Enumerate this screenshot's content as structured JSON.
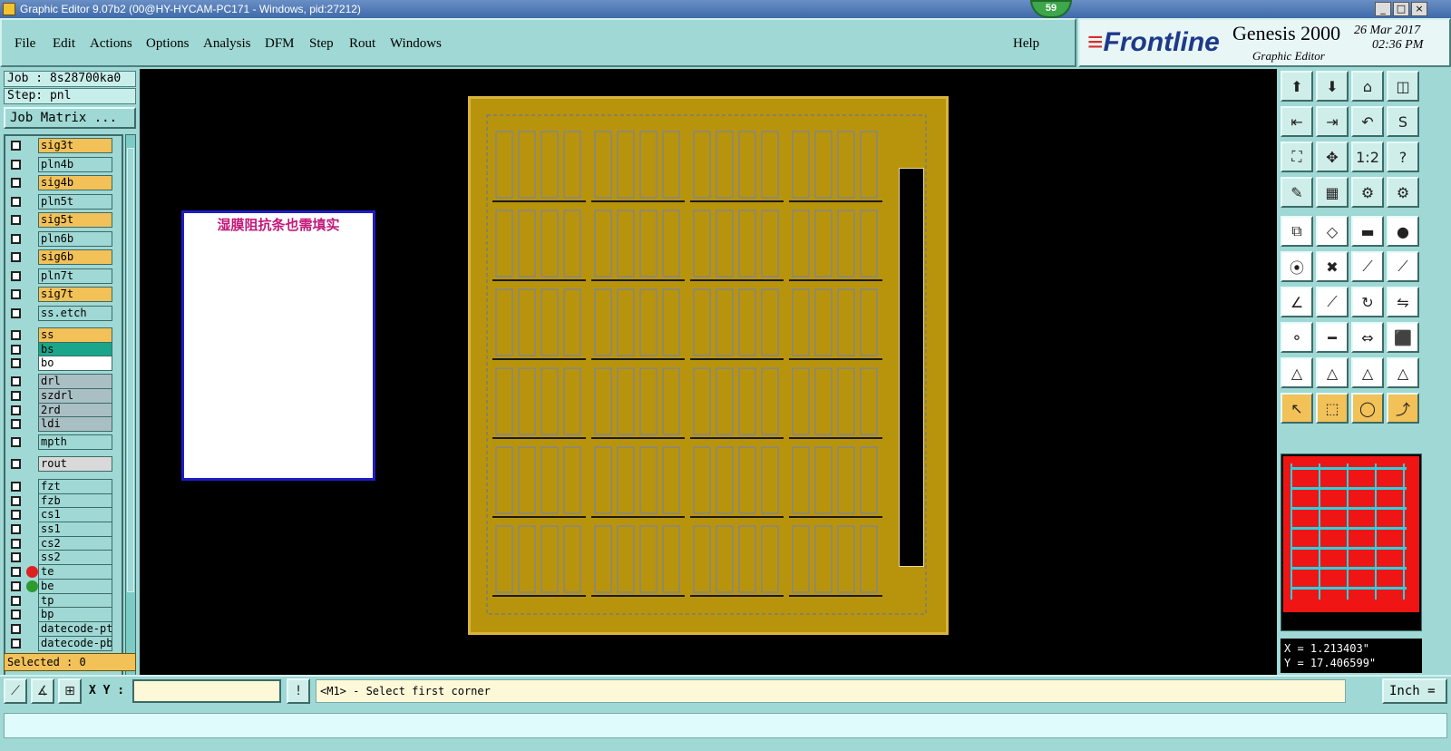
{
  "window": {
    "title": "Graphic Editor 9.07b2 (00@HY-HYCAM-PC171 - Windows, pid:27212)",
    "badge": "59",
    "controls": [
      "_",
      "□",
      "×"
    ]
  },
  "menu": {
    "items": [
      "File",
      "Edit",
      "Actions",
      "Options",
      "Analysis",
      "DFM",
      "Step",
      "Rout",
      "Windows"
    ],
    "help": "Help"
  },
  "brand": {
    "logo": "Frontline",
    "product": "Genesis 2000",
    "subtitle": "Graphic Editor",
    "date": "26 Mar 2017",
    "time": "02:36 PM"
  },
  "job": {
    "job_label": "Job : 8s28700ka0",
    "step_label": "Step: pnl",
    "matrix_button": "Job Matrix ...",
    "selected": "Selected : 0"
  },
  "layers": [
    {
      "name": "sig3t",
      "color": "#f2c158"
    },
    {
      "name": "pln4b",
      "color": "#9fd8d4"
    },
    {
      "name": "sig4b",
      "color": "#f2c158"
    },
    {
      "name": "pln5t",
      "color": "#9fd8d4"
    },
    {
      "name": "sig5t",
      "color": "#f2c158"
    },
    {
      "name": "pln6b",
      "color": "#9fd8d4"
    },
    {
      "name": "sig6b",
      "color": "#f2c158"
    },
    {
      "name": "pln7t",
      "color": "#9fd8d4"
    },
    {
      "name": "sig7t",
      "color": "#f2c158"
    },
    {
      "name": "ss.etch",
      "color": "#9fd8d4"
    },
    {
      "name": "ss",
      "color": "#f2c158"
    },
    {
      "name": "bs",
      "color": "#1aa68a"
    },
    {
      "name": "bo",
      "color": "#ffffff"
    },
    {
      "name": "drl",
      "color": "#a9bfc4"
    },
    {
      "name": "szdrl",
      "color": "#a9bfc4"
    },
    {
      "name": "2rd",
      "color": "#a9bfc4"
    },
    {
      "name": "ldi",
      "color": "#a9bfc4"
    },
    {
      "name": "mpth",
      "color": "#9fd8d4"
    },
    {
      "name": "rout",
      "color": "#d9d9d9"
    },
    {
      "name": "fzt",
      "color": "#9fd8d4"
    },
    {
      "name": "fzb",
      "color": "#9fd8d4"
    },
    {
      "name": "cs1",
      "color": "#9fd8d4"
    },
    {
      "name": "ss1",
      "color": "#9fd8d4"
    },
    {
      "name": "cs2",
      "color": "#9fd8d4"
    },
    {
      "name": "ss2",
      "color": "#9fd8d4"
    },
    {
      "name": "te",
      "color": "#9fd8d4",
      "marker": "#e02020"
    },
    {
      "name": "be",
      "color": "#9fd8d4",
      "marker": "#2e9a2e"
    },
    {
      "name": "tp",
      "color": "#9fd8d4"
    },
    {
      "name": "bp",
      "color": "#9fd8d4"
    },
    {
      "name": "datecode-ptc",
      "color": "#9fd8d4"
    },
    {
      "name": "datecode-pbc",
      "color": "#9fd8d4"
    }
  ],
  "canvas": {
    "note": "湿膜阻抗条也需填实",
    "panel_color": "#b8940c",
    "grid_cols": 4,
    "grid_rows": 6
  },
  "tools": [
    {
      "icon": "zoom-home-icon",
      "glyph": "⬆"
    },
    {
      "icon": "zoom-down-icon",
      "glyph": "⬇"
    },
    {
      "icon": "home-icon",
      "glyph": "⌂"
    },
    {
      "icon": "window-split-icon",
      "glyph": "◫"
    },
    {
      "icon": "pan-left-icon",
      "glyph": "⇤"
    },
    {
      "icon": "pan-right-icon",
      "glyph": "⇥"
    },
    {
      "icon": "undo-zoom-icon",
      "glyph": "↶"
    },
    {
      "icon": "snap-icon",
      "glyph": "S"
    },
    {
      "icon": "fit-icon",
      "glyph": "⛶"
    },
    {
      "icon": "center-icon",
      "glyph": "✥"
    },
    {
      "icon": "ratio-icon",
      "glyph": "1:2"
    },
    {
      "icon": "help-icon",
      "glyph": "?"
    },
    {
      "icon": "measure-icon",
      "glyph": "✎"
    },
    {
      "icon": "grid-icon",
      "glyph": "▦"
    },
    {
      "icon": "layer-toggle-red-icon",
      "glyph": "⚙"
    },
    {
      "icon": "layer-toggle-icon",
      "glyph": "⚙"
    },
    {
      "icon": "copy-icon",
      "glyph": "⧉"
    },
    {
      "icon": "transform-icon",
      "glyph": "◇"
    },
    {
      "icon": "ruler-icon",
      "glyph": "▬"
    },
    {
      "icon": "pad-icon",
      "glyph": "●"
    },
    {
      "icon": "connect-icon",
      "glyph": "⦿"
    },
    {
      "icon": "cross-icon",
      "glyph": "✖"
    },
    {
      "icon": "line-point-icon",
      "glyph": "⟋"
    },
    {
      "icon": "line-point-red-icon",
      "glyph": "⟋"
    },
    {
      "icon": "angle-icon",
      "glyph": "∠"
    },
    {
      "icon": "slash-icon",
      "glyph": "⟋"
    },
    {
      "icon": "rotate-icon",
      "glyph": "↻"
    },
    {
      "icon": "mirror-icon",
      "glyph": "⇋"
    },
    {
      "icon": "node-icon",
      "glyph": "⚬"
    },
    {
      "icon": "dash-icon",
      "glyph": "━"
    },
    {
      "icon": "dimension-icon",
      "glyph": "⇔"
    },
    {
      "icon": "shapes-icon",
      "glyph": "⬛"
    },
    {
      "icon": "triangle-1-icon",
      "glyph": "△"
    },
    {
      "icon": "triangle-2-icon",
      "glyph": "△"
    },
    {
      "icon": "triangle-3-icon",
      "glyph": "△"
    },
    {
      "icon": "triangle-4-icon",
      "glyph": "△"
    },
    {
      "icon": "select-arrow-icon",
      "glyph": "↖"
    },
    {
      "icon": "select-box-icon",
      "glyph": "⬚"
    },
    {
      "icon": "select-circle-icon",
      "glyph": "◯"
    },
    {
      "icon": "select-path-icon",
      "glyph": "⤴"
    }
  ],
  "coords": {
    "x": "X = 1.213403\"",
    "y": "Y = 17.406599\""
  },
  "bottom": {
    "xy_label": "X Y :",
    "xy_value": "",
    "info_icon": "!",
    "status": "<M1> - Select first corner",
    "units": "Inch ="
  }
}
